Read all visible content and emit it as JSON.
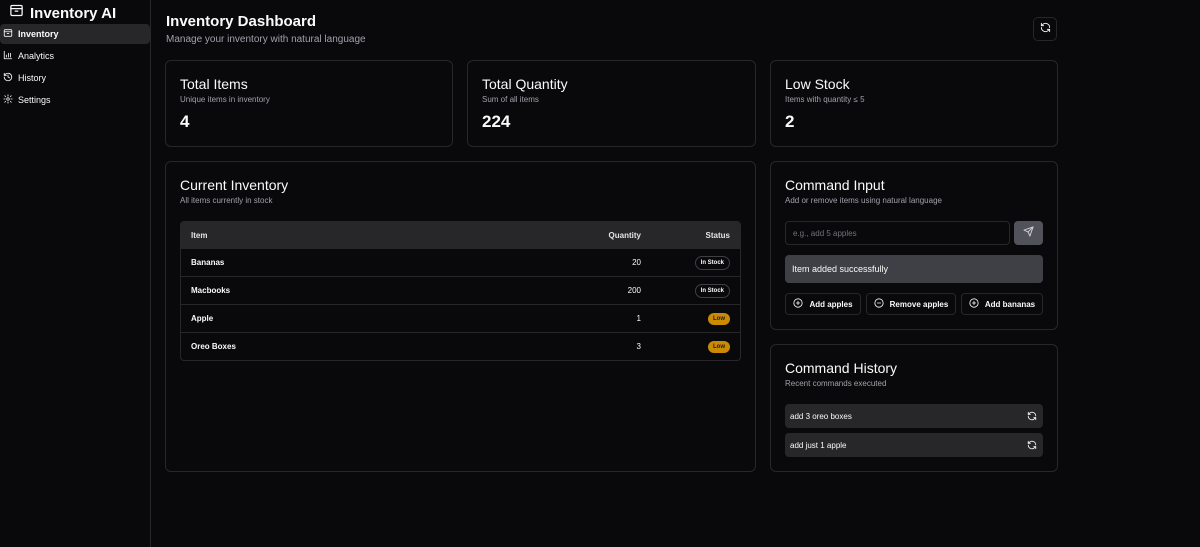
{
  "app": {
    "title": "Inventory AI",
    "logo_icon": "package-icon"
  },
  "sidebar": {
    "items": [
      {
        "label": "Inventory",
        "icon": "package-icon",
        "active": true
      },
      {
        "label": "Analytics",
        "icon": "bar-chart-icon",
        "active": false
      },
      {
        "label": "History",
        "icon": "history-icon",
        "active": false
      },
      {
        "label": "Settings",
        "icon": "gear-icon",
        "active": false
      }
    ]
  },
  "header": {
    "title": "Inventory Dashboard",
    "subtitle": "Manage your inventory with natural language",
    "refresh_icon": "refresh-icon"
  },
  "stats": [
    {
      "title": "Total Items",
      "subtitle": "Unique items in inventory",
      "value": "4"
    },
    {
      "title": "Total Quantity",
      "subtitle": "Sum of all items",
      "value": "224"
    },
    {
      "title": "Low Stock",
      "subtitle": "Items with quantity ≤ 5",
      "value": "2"
    }
  ],
  "inventory": {
    "title": "Current Inventory",
    "subtitle": "All items currently in stock",
    "columns": {
      "item": "Item",
      "quantity": "Quantity",
      "status": "Status"
    },
    "rows": [
      {
        "item": "Bananas",
        "quantity": "20",
        "status": "In Stock",
        "status_kind": "ok"
      },
      {
        "item": "Macbooks",
        "quantity": "200",
        "status": "In Stock",
        "status_kind": "ok"
      },
      {
        "item": "Apple",
        "quantity": "1",
        "status": "Low",
        "status_kind": "low"
      },
      {
        "item": "Oreo Boxes",
        "quantity": "3",
        "status": "Low",
        "status_kind": "low"
      }
    ]
  },
  "command": {
    "title": "Command Input",
    "subtitle": "Add or remove items using natural language",
    "placeholder": "e.g., add 5 apples",
    "value": "",
    "send_icon": "send-icon",
    "message": "Item added successfully",
    "quick_actions": [
      {
        "label": "Add apples",
        "icon": "plus-circle-icon"
      },
      {
        "label": "Remove apples",
        "icon": "minus-circle-icon"
      },
      {
        "label": "Add bananas",
        "icon": "plus-circle-icon"
      }
    ]
  },
  "history": {
    "title": "Command History",
    "subtitle": "Recent commands executed",
    "items": [
      {
        "text": "add 3 oreo boxes",
        "icon": "refresh-icon"
      },
      {
        "text": "add just 1 apple",
        "icon": "refresh-icon"
      }
    ]
  },
  "colors": {
    "background": "#09090b",
    "border": "#27272a",
    "muted_text": "#a1a1aa",
    "low_badge": "#ca8a04",
    "alert_bg": "#3f3f46"
  }
}
